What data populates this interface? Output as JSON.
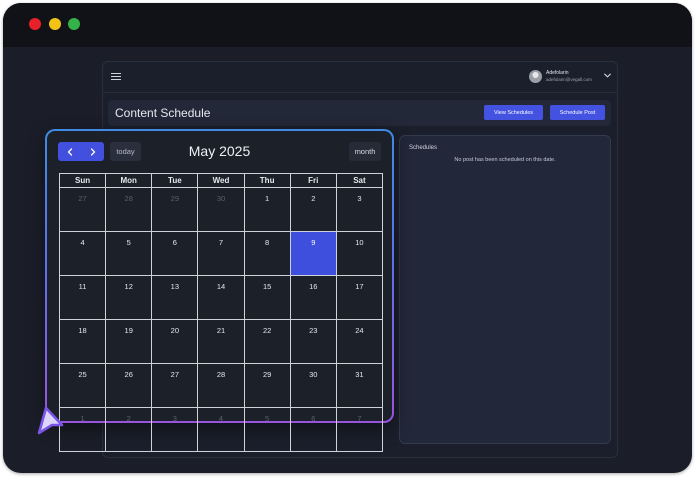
{
  "app": {
    "user": {
      "name": "Adefolarin",
      "email": "adefolarin@vegall.com"
    },
    "page_title": "Content Schedule",
    "view_schedules_label": "View Schedules",
    "schedule_post_label": "Schedule Post"
  },
  "calendar": {
    "title": "May 2025",
    "today_label": "today",
    "view_label": "month",
    "weekdays": [
      "Sun",
      "Mon",
      "Tue",
      "Wed",
      "Thu",
      "Fri",
      "Sat"
    ],
    "weeks": [
      [
        "27",
        "28",
        "29",
        "30",
        "1",
        "2",
        "3"
      ],
      [
        "4",
        "5",
        "6",
        "7",
        "8",
        "9",
        "10"
      ],
      [
        "11",
        "12",
        "13",
        "14",
        "15",
        "16",
        "17"
      ],
      [
        "18",
        "19",
        "20",
        "21",
        "22",
        "23",
        "24"
      ],
      [
        "25",
        "26",
        "27",
        "28",
        "29",
        "30",
        "31"
      ],
      [
        "1",
        "2",
        "3",
        "4",
        "5",
        "6",
        "7"
      ]
    ],
    "selected_day": "9"
  },
  "schedules": {
    "title": "Schedules",
    "empty_message": "No post has been scheduled on this date."
  },
  "colors": {
    "accent": "#4452e2",
    "window_bg": "#1b1e29",
    "titlebar_bg": "#111217",
    "traffic_red": "#e7202a",
    "traffic_yellow": "#f2c316",
    "traffic_green": "#35b14a"
  },
  "icons": {
    "menu": "hamburger-icon",
    "prev": "chevron-left-icon",
    "next": "chevron-right-icon",
    "dropdown": "chevron-down-icon",
    "pointer": "cursor-arrow-icon"
  }
}
